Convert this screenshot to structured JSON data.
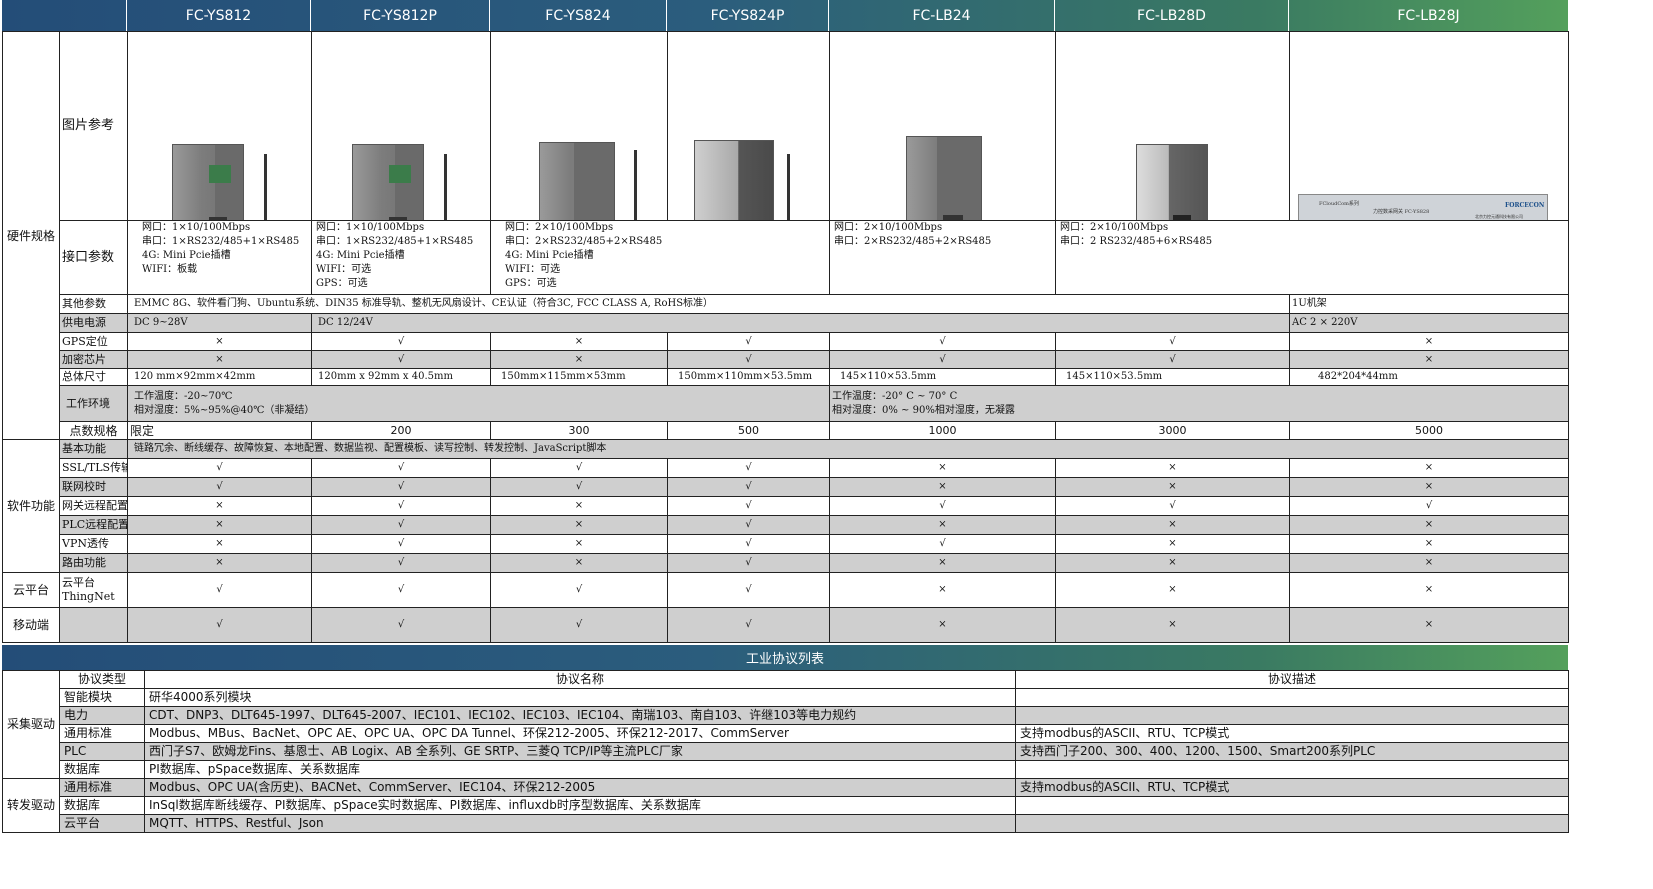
{
  "models": [
    "FC-YS812",
    "FC-YS812P",
    "FC-YS824",
    "FC-YS824P",
    "FC-LB24",
    "FC-LB28D",
    "FC-LB28J"
  ],
  "sections": {
    "hardware": "硬件规格",
    "points": "点数规格",
    "software": "软件功能",
    "cloud": "云平台",
    "mobile": "移动端"
  },
  "rows": {
    "image_ref": "图片参考",
    "interface": "接口参数",
    "other": "其他参数",
    "power": "供电电源",
    "gps": "GPS定位",
    "crypto": "加密芯片",
    "size": "总体尺寸",
    "env": "工作环境",
    "limit": "限定",
    "basic": "基本功能",
    "ssl": "SSL/TLS传输",
    "ntp": "联网校时",
    "remote_cfg": "网关远程配置",
    "plc_cfg": "PLC远程配置",
    "vpn": "VPN透传",
    "routing": "路由功能",
    "cloud_label": "云平台",
    "cloud_sub": "ThingNet"
  },
  "interface": {
    "ys812": [
      "网口：1×10/100Mbps",
      "串口：1×RS232/485+1×RS485",
      "4G: Mini Pcie插槽",
      "WIFI：板载"
    ],
    "ys812p": [
      "网口：1×10/100Mbps",
      "串口：1×RS232/485+1×RS485",
      "4G: Mini Pcie插槽",
      "WIFI：可选",
      "GPS：可选"
    ],
    "ys824": [
      "网口：2×10/100Mbps",
      "串口：2×RS232/485+2×RS485",
      "4G: Mini Pcie插槽",
      "WIFI：可选",
      "GPS：可选"
    ],
    "lb24": [
      "网口：2×10/100Mbps",
      "串口：2×RS232/485+2×RS485"
    ],
    "lb28": [
      "网口：2×10/100Mbps",
      "串口：2 RS232/485+6×RS485"
    ]
  },
  "other": {
    "main": "EMMC 8G、软件看门狗、Ubuntu系统、DIN35 标准导轨、整机无风扇设计、CE认证（符合3C, FCC CLASS A, RoHS标准）",
    "lb28j": "1U机架"
  },
  "power": {
    "ys812": "DC 9~28V",
    "mid": "DC 12/24V",
    "lb28j": "AC  2 × 220V"
  },
  "gps": [
    "×",
    "√",
    "×",
    "√",
    "√",
    "√",
    "×"
  ],
  "crypto": [
    "×",
    "√",
    "×",
    "√",
    "√",
    "√",
    "×"
  ],
  "size": [
    "120 mm×92mm×42mm",
    "120mm x 92mm x 40.5mm",
    "150mm×115mm×53mm",
    "150mm×110mm×53.5mm",
    "145×110×53.5mm",
    "145×110×53.5mm",
    "482*204*44mm"
  ],
  "env": {
    "a1": "工作温度：-20~70℃",
    "a2": "相对湿度：5%~95%@40℃（非凝结）",
    "b1": "工作温度：-20° C ~ 70° C",
    "b2": "相对湿度：0% ~ 90%相对湿度，无凝露"
  },
  "limits": [
    "200",
    "300",
    "500",
    "1000",
    "3000",
    "5000",
    "5000"
  ],
  "basic_text": "链路冗余、断线缓存、故障恢复、本地配置、数据监视、配置模板、读写控制、转发控制、JavaScript脚本",
  "ssl": [
    "√",
    "√",
    "√",
    "√",
    "×",
    "×",
    "×"
  ],
  "ntp": [
    "√",
    "√",
    "√",
    "√",
    "×",
    "×",
    "×"
  ],
  "remote_cfg": [
    "×",
    "√",
    "×",
    "√",
    "√",
    "√",
    "√"
  ],
  "plc_cfg": [
    "×",
    "√",
    "×",
    "√",
    "×",
    "×",
    "×"
  ],
  "vpn": [
    "×",
    "√",
    "×",
    "√",
    "√",
    "×",
    "×"
  ],
  "routing": [
    "×",
    "√",
    "×",
    "√",
    "×",
    "×",
    "×"
  ],
  "cloud": [
    "√",
    "√",
    "√",
    "√",
    "×",
    "×",
    "×"
  ],
  "mobile": [
    "√",
    "√",
    "√",
    "√",
    "×",
    "×",
    "×"
  ],
  "rack_text": {
    "series": "FCloudCom系列",
    "name": "力控数采网关 FC-YS828",
    "brand": "FORCECON",
    "company": "北京力控元通科技有限公司"
  },
  "protocol": {
    "title": "工业协议列表",
    "col_type": "协议类型",
    "col_name": "协议名称",
    "col_desc": "协议描述",
    "collect": "采集驱动",
    "forward": "转发驱动",
    "rows": [
      {
        "type": "智能模块",
        "name": "研华4000系列模块",
        "desc": ""
      },
      {
        "type": "电力",
        "name": "CDT、DNP3、DLT645-1997、DLT645-2007、IEC101、IEC102、IEC103、IEC104、南瑞103、南自103、许继103等电力规约",
        "desc": ""
      },
      {
        "type": "通用标准",
        "name": "Modbus、MBus、BacNet、OPC AE、OPC UA、OPC DA Tunnel、环保212-2005、环保212-2017、CommServer",
        "desc": "支持modbus的ASCII、RTU、TCP模式"
      },
      {
        "type": "PLC",
        "name": "西门子S7、欧姆龙Fins、基恩士、AB Logix、AB 全系列、GE SRTP、三菱Q TCP/IP等主流PLC厂家",
        "desc": "支持西门子200、300、400、1200、1500、Smart200系列PLC"
      },
      {
        "type": "数据库",
        "name": "PI数据库、pSpace数据库、关系数据库",
        "desc": ""
      }
    ],
    "frows": [
      {
        "type": "通用标准",
        "name": "Modbus、OPC UA(含历史)、BACNet、CommServer、IEC104、环保212-2005",
        "desc": "支持modbus的ASCII、RTU、TCP模式"
      },
      {
        "type": "数据库",
        "name": "InSql数据库断线缓存、PI数据库、pSpace实时数据库、PI数据库、influxdb时序型数据库、关系数据库",
        "desc": ""
      },
      {
        "type": "云平台",
        "name": "MQTT、HTTPS、Restful、Json",
        "desc": ""
      }
    ]
  }
}
